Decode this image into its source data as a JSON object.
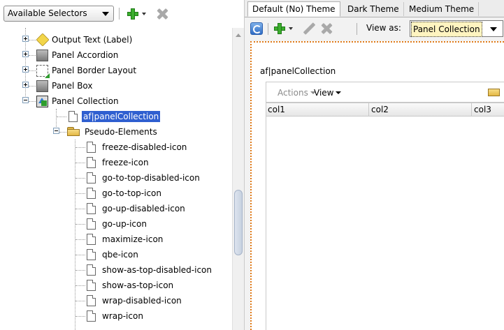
{
  "left_toolbar": {
    "selector_button": "Available Selectors",
    "add_icon": "plus-icon",
    "delete_icon": "delete-x-icon"
  },
  "tree": {
    "items": [
      {
        "label": "Output Text (Label)",
        "icon": "tag-icon",
        "expander": "plus"
      },
      {
        "label": "Panel Accordion",
        "icon": "panel-icon",
        "expander": "plus"
      },
      {
        "label": "Panel Border Layout",
        "icon": "border-layout-icon",
        "expander": "plus"
      },
      {
        "label": "Panel Box",
        "icon": "panel-icon",
        "expander": "plus"
      },
      {
        "label": "Panel Collection",
        "icon": "panel-collection-icon",
        "expander": "minus"
      },
      {
        "label": "af|panelCollection",
        "icon": "document-icon",
        "selected": true
      },
      {
        "label": "Pseudo-Elements",
        "icon": "folder-open-icon",
        "expander": "minus"
      },
      {
        "label": "freeze-disabled-icon",
        "icon": "document-icon"
      },
      {
        "label": "freeze-icon",
        "icon": "document-icon"
      },
      {
        "label": "go-to-top-disabled-icon",
        "icon": "document-icon"
      },
      {
        "label": "go-to-top-icon",
        "icon": "document-icon"
      },
      {
        "label": "go-up-disabled-icon",
        "icon": "document-icon"
      },
      {
        "label": "go-up-icon",
        "icon": "document-icon"
      },
      {
        "label": "maximize-icon",
        "icon": "document-icon"
      },
      {
        "label": "qbe-icon",
        "icon": "document-icon"
      },
      {
        "label": "show-as-top-disabled-icon",
        "icon": "document-icon"
      },
      {
        "label": "show-as-top-icon",
        "icon": "document-icon"
      },
      {
        "label": "wrap-disabled-icon",
        "icon": "document-icon"
      },
      {
        "label": "wrap-icon",
        "icon": "document-icon"
      }
    ]
  },
  "theme_tabs": [
    {
      "label": "Default (No) Theme",
      "active": true
    },
    {
      "label": "Dark Theme",
      "active": false
    },
    {
      "label": "Medium Theme",
      "active": false
    }
  ],
  "right_toolbar": {
    "view_as_label": "View as:",
    "view_as_value": "Panel Collection"
  },
  "preview": {
    "component_title": "af|panelCollection",
    "menus": [
      "Actions",
      "View"
    ],
    "columns": [
      "col1",
      "col2",
      "col3"
    ]
  },
  "colors": {
    "selection": "#2f5fd0",
    "canvas_border": "#e07a18",
    "add_green": "#3cae2e"
  }
}
